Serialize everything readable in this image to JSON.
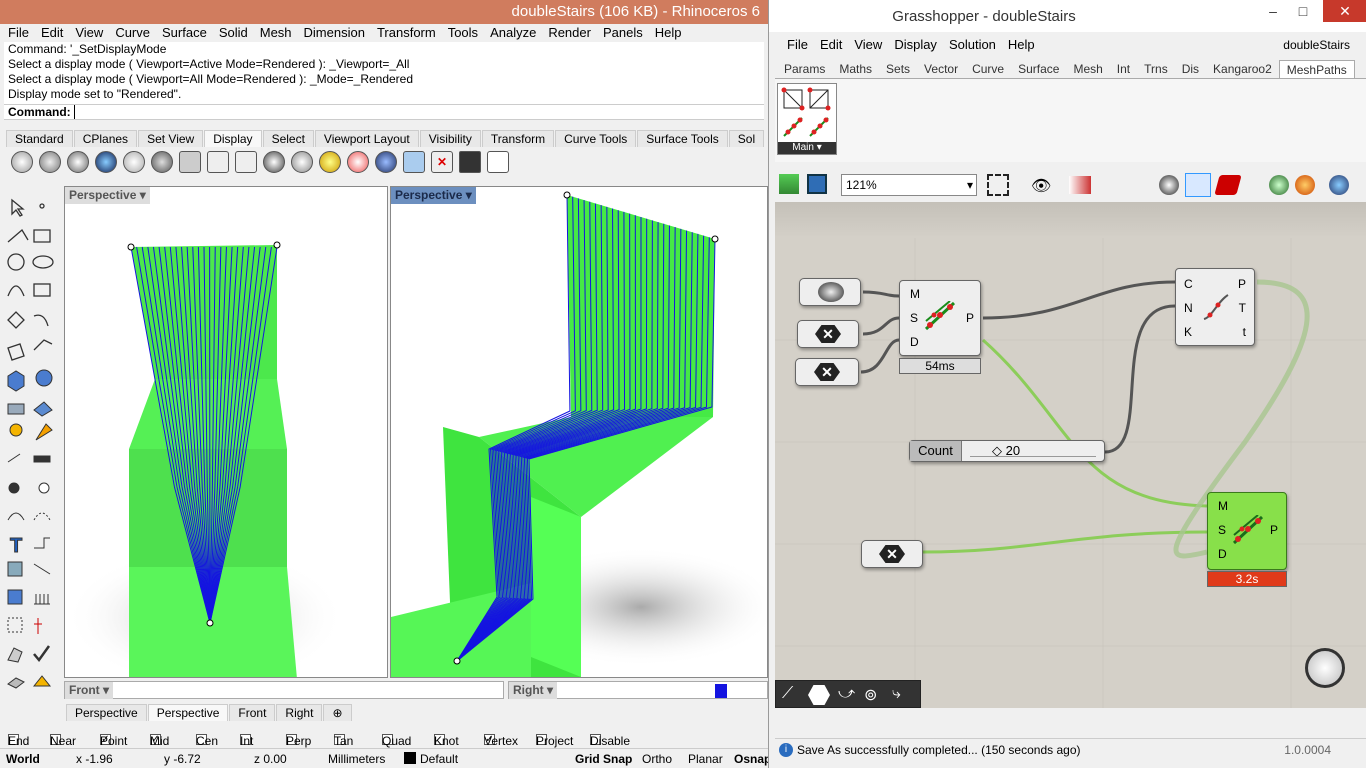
{
  "rhino": {
    "title": "doubleStairs (106 KB) - Rhinoceros 6",
    "menu": [
      "File",
      "Edit",
      "View",
      "Curve",
      "Surface",
      "Solid",
      "Mesh",
      "Dimension",
      "Transform",
      "Tools",
      "Analyze",
      "Render",
      "Panels",
      "Help"
    ],
    "history": [
      "Command: '_SetDisplayMode",
      "Select a display mode ( Viewport=Active  Mode=Rendered ): _Viewport=_All",
      "Select a display mode ( Viewport=All  Mode=Rendered ): _Mode=_Rendered",
      "Display mode set to \"Rendered\"."
    ],
    "command_label": "Command:",
    "toolbar_tabs": [
      "Standard",
      "CPlanes",
      "Set View",
      "Display",
      "Select",
      "Viewport Layout",
      "Visibility",
      "Transform",
      "Curve Tools",
      "Surface Tools",
      "Sol"
    ],
    "active_toolbar_tab": "Display",
    "viewports": {
      "left": "Perspective",
      "right": "Perspective",
      "bottom_left": "Front",
      "bottom_right": "Right"
    },
    "viewport_tabs": [
      "Perspective",
      "Perspective",
      "Front",
      "Right"
    ],
    "osnaps": [
      {
        "label": "End",
        "checked": false
      },
      {
        "label": "Near",
        "checked": false
      },
      {
        "label": "Point",
        "checked": true
      },
      {
        "label": "Mid",
        "checked": true
      },
      {
        "label": "Cen",
        "checked": false
      },
      {
        "label": "Int",
        "checked": false
      },
      {
        "label": "Perp",
        "checked": false
      },
      {
        "label": "Tan",
        "checked": false
      },
      {
        "label": "Quad",
        "checked": false
      },
      {
        "label": "Knot",
        "checked": false
      },
      {
        "label": "Vertex",
        "checked": true
      },
      {
        "label": "Project",
        "checked": false
      },
      {
        "label": "Disable",
        "checked": false
      }
    ],
    "status": {
      "cplane": "World",
      "x": "x -1.96",
      "y": "y -6.72",
      "z": "z 0.00",
      "units": "Millimeters",
      "layer": "Default",
      "grid_snap": "Grid Snap",
      "ortho": "Ortho",
      "planar": "Planar",
      "osnap": "Osnap"
    }
  },
  "gh": {
    "title": "Grasshopper - doubleStairs",
    "menu": [
      "File",
      "Edit",
      "View",
      "Display",
      "Solution",
      "Help"
    ],
    "doc_name": "doubleStairs",
    "tabs": [
      "Params",
      "Maths",
      "Sets",
      "Vector",
      "Curve",
      "Surface",
      "Mesh",
      "Int",
      "Trns",
      "Dis",
      "Kangaroo2",
      "MeshPaths"
    ],
    "active_tab": "MeshPaths",
    "panel_label": "Main",
    "zoom": "121%",
    "component1": {
      "inputs": [
        "M",
        "S",
        "D"
      ],
      "output": "P",
      "time": "54ms"
    },
    "component2": {
      "inputs": [
        "C",
        "N",
        "K"
      ],
      "outputs": [
        "P",
        "T",
        "t"
      ]
    },
    "component3": {
      "inputs": [
        "M",
        "S",
        "D"
      ],
      "output": "P",
      "time": "3.2s"
    },
    "slider": {
      "label": "Count",
      "value": "◇ 20"
    },
    "status_msg": "Save As successfully completed... (150 seconds ago)",
    "version": "1.0.0004"
  },
  "colors": {
    "rhino_title": "#d07c5e",
    "surface_green": "#4cf04c",
    "curve_blue": "#1414e0",
    "wire": "#555555",
    "wire_green": "#8ccd5a",
    "error": "#e03a1a"
  }
}
